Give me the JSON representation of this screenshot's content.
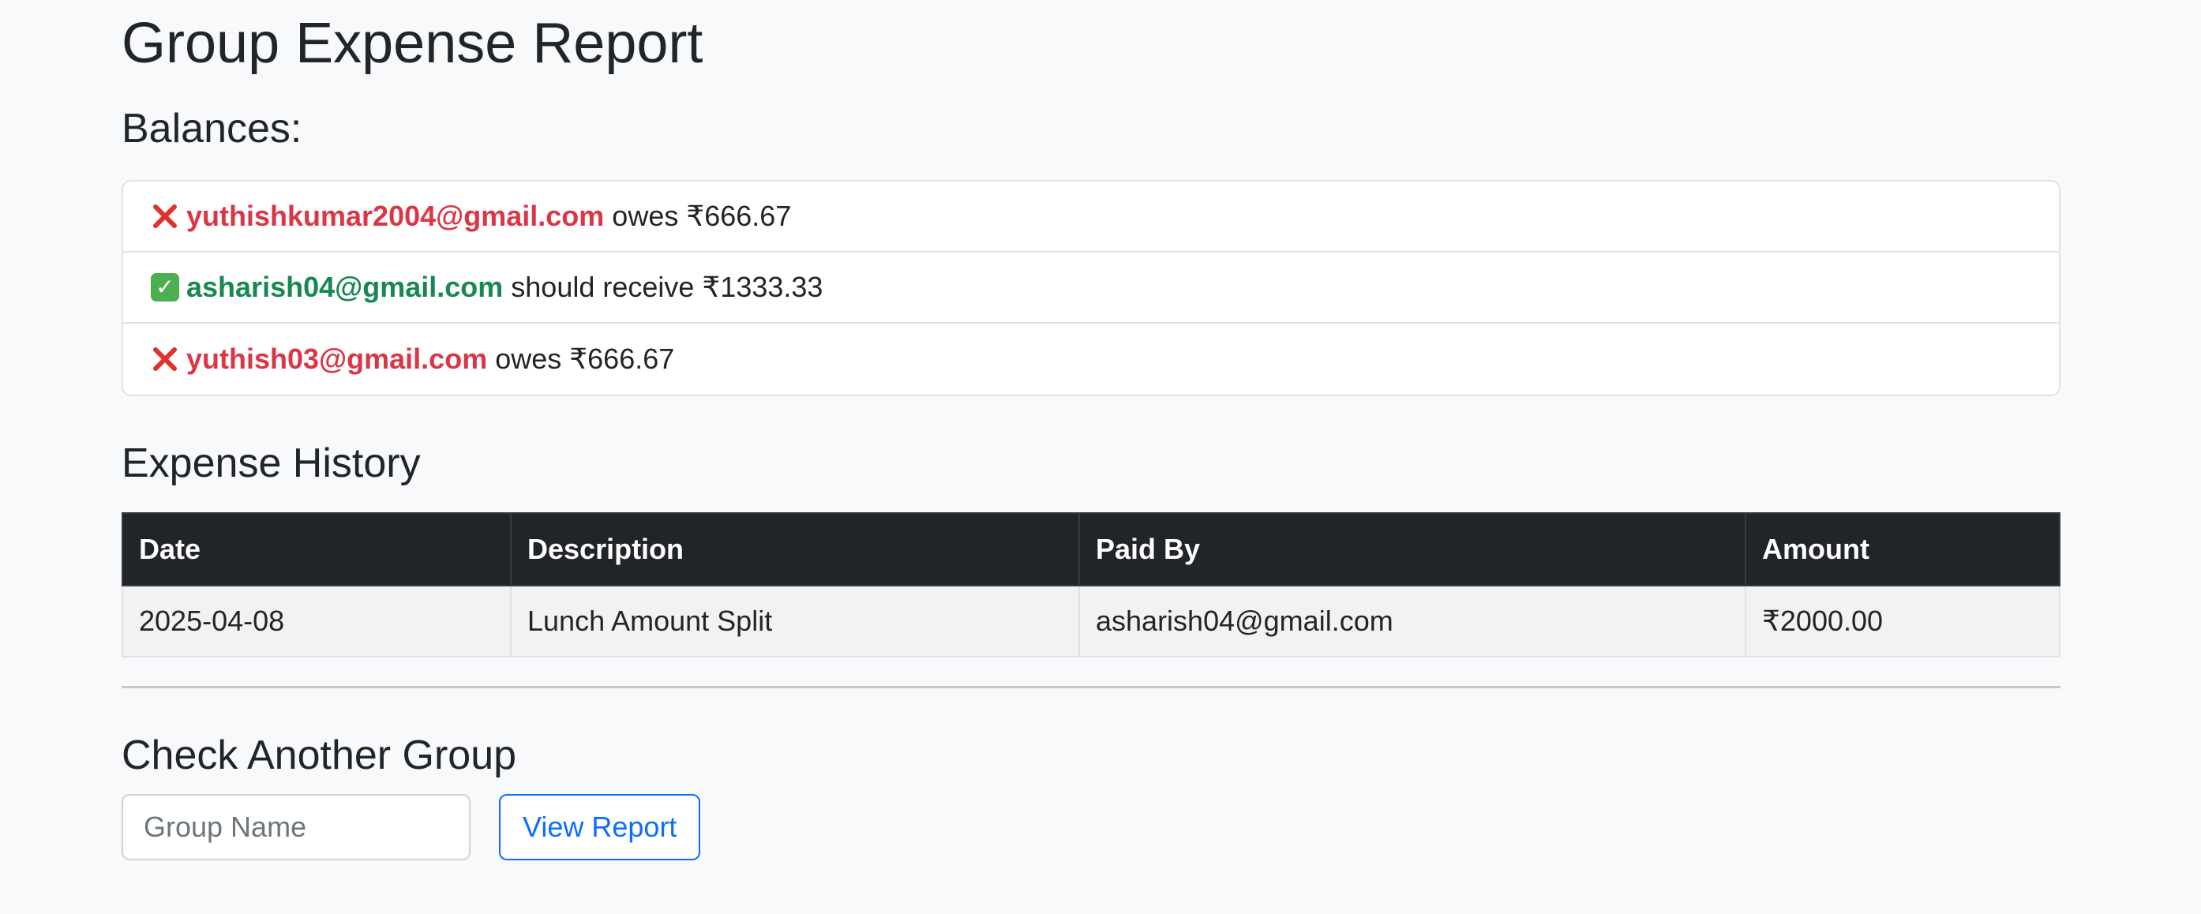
{
  "page": {
    "title": "Group Expense Report"
  },
  "balances": {
    "heading": "Balances:",
    "items": [
      {
        "status": "owes",
        "icon": "cross-mark-icon",
        "email": "yuthishkumar2004@gmail.com",
        "text": "owes ₹666.67"
      },
      {
        "status": "receives",
        "icon": "check-mark-icon",
        "email": "asharish04@gmail.com",
        "text": "should receive ₹1333.33"
      },
      {
        "status": "owes",
        "icon": "cross-mark-icon",
        "email": "yuthish03@gmail.com",
        "text": "owes ₹666.67"
      }
    ]
  },
  "history": {
    "heading": "Expense History",
    "columns": [
      "Date",
      "Description",
      "Paid By",
      "Amount"
    ],
    "rows": [
      {
        "date": "2025-04-08",
        "description": "Lunch Amount Split",
        "paid_by": "asharish04@gmail.com",
        "amount": "₹2000.00"
      }
    ]
  },
  "check_group": {
    "heading": "Check Another Group",
    "input_placeholder": "Group Name",
    "input_value": "",
    "button_label": "View Report"
  },
  "colors": {
    "owe": "#dc3545",
    "receive": "#198754",
    "table_header": "#212529",
    "button": "#0d6efd"
  }
}
